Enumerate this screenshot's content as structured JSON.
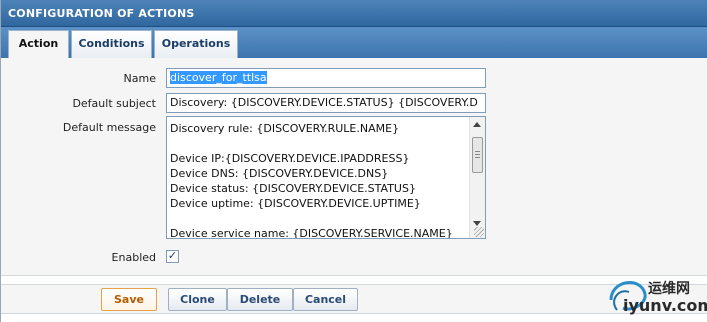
{
  "window": {
    "title": "CONFIGURATION OF ACTIONS"
  },
  "tabs": [
    {
      "label": "Action",
      "active": true
    },
    {
      "label": "Conditions",
      "active": false
    },
    {
      "label": "Operations",
      "active": false
    }
  ],
  "form": {
    "name": {
      "label": "Name",
      "value": "discover_for_ttlsa"
    },
    "default_subject": {
      "label": "Default subject",
      "value": "Discovery: {DISCOVERY.DEVICE.STATUS} {DISCOVERY.D"
    },
    "default_message": {
      "label": "Default message",
      "lines": [
        "Discovery rule: {DISCOVERY.RULE.NAME}",
        "",
        "Device IP:{DISCOVERY.DEVICE.IPADDRESS}",
        "Device DNS: {DISCOVERY.DEVICE.DNS}",
        "Device status: {DISCOVERY.DEVICE.STATUS}",
        "Device uptime: {DISCOVERY.DEVICE.UPTIME}",
        "",
        "Device service name: {DISCOVERY.SERVICE.NAME}"
      ]
    },
    "enabled": {
      "label": "Enabled",
      "checked": true,
      "check_glyph": "✓"
    }
  },
  "buttons": {
    "save": "Save",
    "clone": "Clone",
    "delete": "Delete",
    "cancel": "Cancel"
  },
  "watermark": {
    "line1": "运维网",
    "line2": "iyunv.com"
  },
  "colors": {
    "header": "#2f679f",
    "tab_strip": "#3d74ad",
    "form_bg": "#f5f5f5",
    "selection": "#3399ff",
    "save_border": "#e4a24c"
  }
}
